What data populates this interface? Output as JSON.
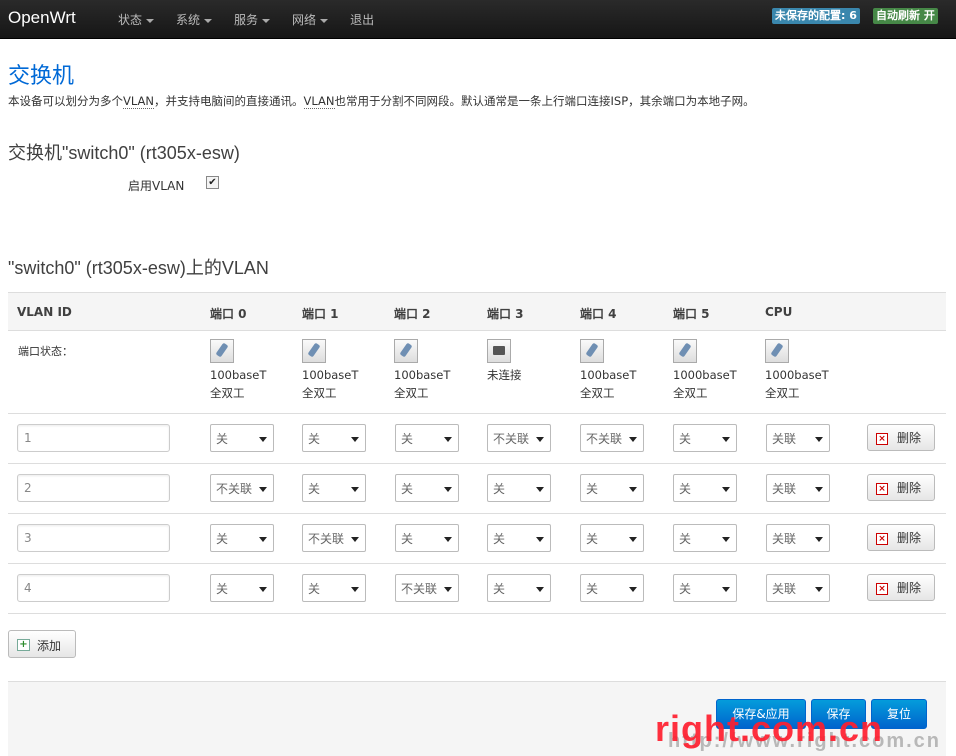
{
  "nav": {
    "brand": "OpenWrt",
    "menu": [
      {
        "label": "状态",
        "has_caret": true
      },
      {
        "label": "系统",
        "has_caret": true
      },
      {
        "label": "服务",
        "has_caret": true
      },
      {
        "label": "网络",
        "has_caret": true
      },
      {
        "label": "退出",
        "has_caret": false
      }
    ],
    "unsaved_badge": "未保存的配置: 6",
    "auto_refresh_badge": "自动刷新 开"
  },
  "page": {
    "title": "交换机",
    "desc_prefix": "本设备可以划分为多个",
    "desc_vlan1": "VLAN",
    "desc_middle": "，并支持电脑间的直接通讯。",
    "desc_vlan2": "VLAN",
    "desc_suffix": "也常用于分割不同网段。默认通常是一条上行端口连接ISP，其余端口为本地子网。"
  },
  "switch_section": {
    "title": "交换机\"switch0\" (rt305x-esw)",
    "enable_vlan_label": "启用VLAN",
    "enable_vlan_checked": true
  },
  "vlan_section": {
    "title": "\"switch0\" (rt305x-esw)上的VLAN",
    "headers": [
      "VLAN ID",
      "端口 0",
      "端口 1",
      "端口 2",
      "端口 3",
      "端口 4",
      "端口 5",
      "CPU"
    ],
    "status_label": "端口状态：",
    "ports": [
      {
        "icon": "port-connected-icon",
        "line1": "100baseT",
        "line2": "全双工"
      },
      {
        "icon": "port-connected-icon",
        "line1": "100baseT",
        "line2": "全双工"
      },
      {
        "icon": "port-connected-icon",
        "line1": "100baseT",
        "line2": "全双工"
      },
      {
        "icon": "port-disconnected-icon",
        "line1": "未连接",
        "line2": ""
      },
      {
        "icon": "port-connected-icon",
        "line1": "100baseT",
        "line2": "全双工"
      },
      {
        "icon": "port-connected-icon",
        "line1": "1000baseT",
        "line2": "全双工"
      },
      {
        "icon": "port-connected-icon",
        "line1": "1000baseT",
        "line2": "全双工"
      }
    ],
    "rows": [
      {
        "vlan_id": "1",
        "ports": [
          "关",
          "关",
          "关",
          "不关联",
          "不关联",
          "关",
          "关联"
        ]
      },
      {
        "vlan_id": "2",
        "ports": [
          "不关联",
          "关",
          "关",
          "关",
          "关",
          "关",
          "关联"
        ]
      },
      {
        "vlan_id": "3",
        "ports": [
          "关",
          "不关联",
          "关",
          "关",
          "关",
          "关",
          "关联"
        ]
      },
      {
        "vlan_id": "4",
        "ports": [
          "关",
          "关",
          "不关联",
          "关",
          "关",
          "关",
          "关联"
        ]
      }
    ],
    "delete_label": "删除",
    "add_label": "添加"
  },
  "footer": {
    "save_apply": "保存&应用",
    "save": "保存",
    "reset": "复位"
  },
  "watermark": {
    "text": "right.com.cn",
    "subtext": "http://www.right.com.cn"
  }
}
